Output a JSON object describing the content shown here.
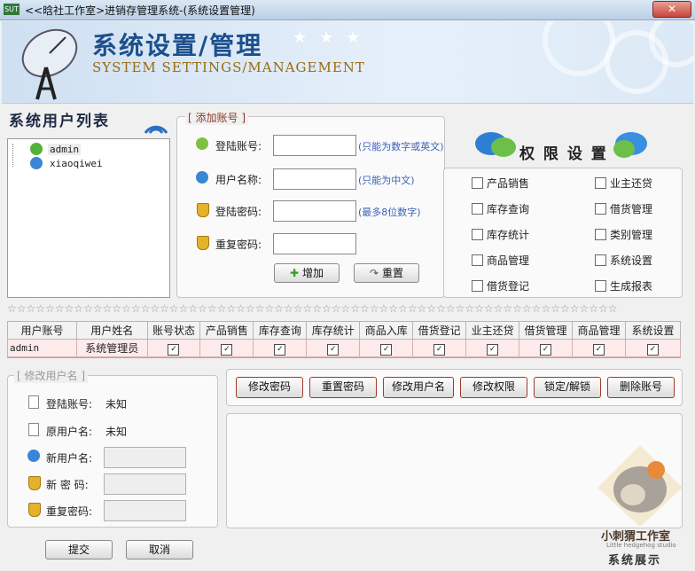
{
  "window": {
    "title": "<<晗社工作室>进销存管理系统-(系统设置管理)",
    "app_icon_text": "SUT",
    "close_label": "✕"
  },
  "banner": {
    "title": "系统设置/管理",
    "subtitle": "SYSTEM SETTINGS/MANAGEMENT",
    "stars": "★★★"
  },
  "users": {
    "header": "系统用户列表",
    "items": [
      "admin",
      "xiaoqiwei"
    ]
  },
  "add_account": {
    "legend": "添加账号",
    "fields": [
      {
        "label": "登陆账号:",
        "hint": "(只能为数字或英文)"
      },
      {
        "label": "用户名称:",
        "hint": "(只能为中文)"
      },
      {
        "label": "登陆密码:",
        "hint": "(最多8位数字)"
      },
      {
        "label": "重复密码:",
        "hint": ""
      }
    ],
    "add_button": "增加",
    "reset_button": "重置"
  },
  "permissions": {
    "title": "权 限 设 置",
    "left": [
      "产品销售",
      "库存查询",
      "库存统计",
      "商品管理",
      "借货登记"
    ],
    "right": [
      "业主还贷",
      "借货管理",
      "类别管理",
      "系统设置",
      "生成报表"
    ]
  },
  "divider_stars": "☆☆☆☆☆☆☆☆☆☆☆☆☆☆☆☆☆☆☆☆☆☆☆☆☆☆☆☆☆☆☆☆☆☆☆☆☆☆☆☆☆☆☆☆☆☆☆☆☆☆☆☆☆☆☆☆☆☆☆☆☆☆☆☆",
  "table": {
    "columns": [
      "用户账号",
      "用户姓名",
      "账号状态",
      "产品销售",
      "库存查询",
      "库存统计",
      "商品入库",
      "借货登记",
      "业主还贷",
      "借货管理",
      "商品管理",
      "系统设置"
    ],
    "rows": [
      {
        "account": "admin",
        "name": "系统管理员",
        "checks": [
          true,
          true,
          true,
          true,
          true,
          true,
          true,
          true,
          true,
          true
        ]
      }
    ]
  },
  "modify_user": {
    "legend": "修改用户名",
    "login_label": "登陆账号:",
    "login_value": "未知",
    "orig_label": "原用户名:",
    "orig_value": "未知",
    "new_label": "新用户名:",
    "pwd_label": "新 密 码:",
    "repeat_label": "重复密码:",
    "submit": "提交",
    "cancel": "取消"
  },
  "actions": [
    "修改密码",
    "重置密码",
    "修改用户名",
    "修改权限",
    "锁定/解锁",
    "删除账号"
  ],
  "watermark": {
    "line1": "小刺猬工作室",
    "line2": "Little hedgehog studio",
    "line3": "系统展示"
  }
}
